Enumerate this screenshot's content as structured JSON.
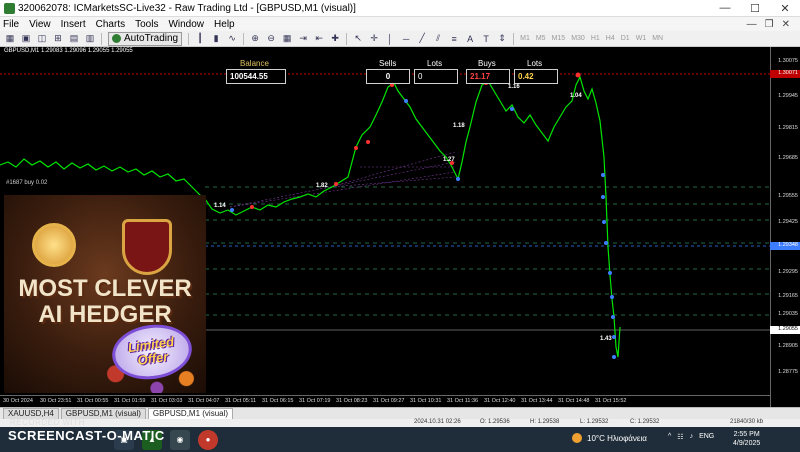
{
  "window": {
    "title": "320062078: ICMarketsSC-Live32 - Raw Trading Ltd - [GBPUSD,M1 (visual)]",
    "buttons": [
      "—",
      "☐",
      "✕"
    ]
  },
  "menu": [
    "File",
    "View",
    "Insert",
    "Charts",
    "Tools",
    "Window",
    "Help"
  ],
  "toolbar": {
    "autotrading_label": "AutoTrading",
    "timeframes": [
      "M1",
      "M5",
      "M15",
      "M30",
      "H1",
      "H4",
      "D1",
      "W1",
      "MN"
    ]
  },
  "chart": {
    "symbol_line": "GBPUSD,M1  1.29083 1.29096 1.29055 1.29055",
    "order_label": "#1687 buy 0.02",
    "panel": {
      "balance_label": "Balance",
      "balance_value": "100544.55",
      "sells_label": "Sells",
      "sells_value": "0",
      "lots_label_1": "Lots",
      "lots_value_1": "0",
      "buys_label": "Buys",
      "buys_value": "21.17",
      "lots_label_2": "Lots",
      "lots_value_2": "0.42"
    },
    "lot_labels": [
      "1.14",
      "1.82",
      "1.27",
      "1.18",
      "1.16",
      "1.04",
      "1.43"
    ],
    "price_levels": [
      "1.30075",
      "1.29945",
      "1.29815",
      "1.29685",
      "1.29555",
      "1.29425",
      "1.29295",
      "1.29165",
      "1.29035",
      "1.28905",
      "1.28775"
    ],
    "price_highlight_red": "1.30071",
    "price_highlight_blue": "1.29348",
    "price_highlight_white": "1.29055",
    "time_labels": [
      "30 Oct 2024",
      "30 Oct 23:51",
      "31 Oct 00:55",
      "31 Oct 01:59",
      "31 Oct 03:03",
      "31 Oct 04:07",
      "31 Oct 05:11",
      "31 Oct 06:15",
      "31 Oct 07:19",
      "31 Oct 08:23",
      "31 Oct 09:27",
      "31 Oct 10:31",
      "31 Oct 11:36",
      "31 Oct 12:40",
      "31 Oct 13:44",
      "31 Oct 14:48",
      "31 Oct 15:52"
    ],
    "colors": {
      "price_line": "#00e600",
      "red_level": "#c00000",
      "grid_dashed": "#2e8b57",
      "marker_blue": "#3d7dff",
      "marker_red": "#ff3030"
    }
  },
  "promo": {
    "line1": "MOST CLEVER",
    "line2": "AI HEDGER",
    "badge_line1": "Limited",
    "badge_line2": "Offer"
  },
  "tabs": [
    "XAUUSD,H4",
    "GBPUSD,M1 (visual)",
    "GBPUSD,M1 (visual)"
  ],
  "status": {
    "datetime": "2024.10.31 02:26",
    "open": "O: 1.29536",
    "high": "H: 1.29538",
    "low": "L: 1.29532",
    "close": "C: 1.29532",
    "traffic": "21840/30 kb"
  },
  "taskbar": {
    "watermark_top": "RECORDED WITH",
    "watermark": "SCREENCAST-O-MATIC",
    "weather": "10°C  Ηλιοφάνεια",
    "language": "ENG",
    "time": "2:55 PM",
    "date": "4/9/2025"
  }
}
